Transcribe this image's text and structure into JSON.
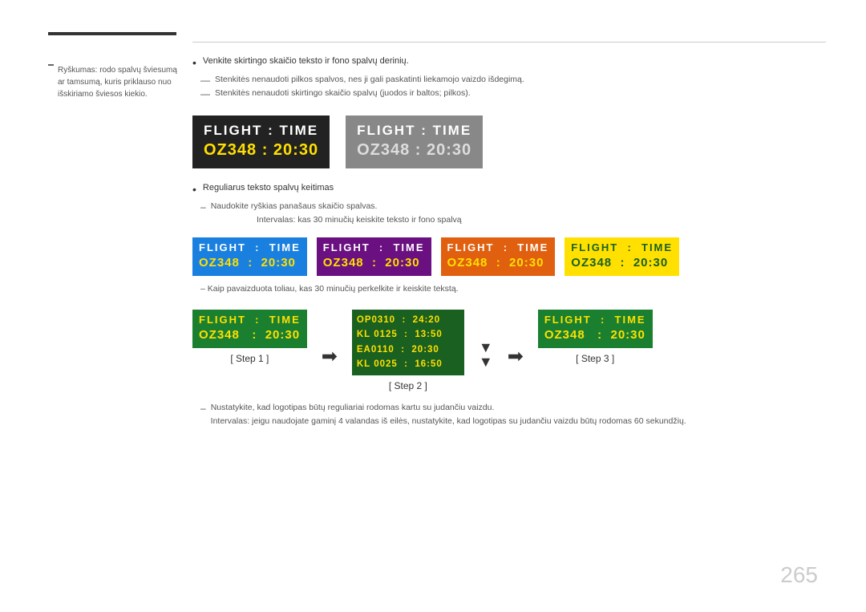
{
  "page": {
    "number": "265"
  },
  "sidebar": {
    "dash_label": "—",
    "text": "Ryškumas: rodo spalvų šviesumą ar tamsumą, kuris priklauso nuo išskiriamo šviesos kiekio."
  },
  "bullets": {
    "item1": "Venkite skirtingo skaičio teksto ir fono spalvų derinių.",
    "dash1": "Stenkitės nenaudoti pilkos spalvos, nes ji gali paskatinti liekamojo vaizdo išdegimą.",
    "dash2": "Stenkitės nenaudoti skirtingo skaičio spalvų (juodos ir baltos; pilkos)."
  },
  "big_boxes": {
    "box1": {
      "row1": "FLIGHT  :  TIME",
      "row2": "OZ348   :  20:30"
    },
    "box2": {
      "row1": "FLIGHT  :  TIME",
      "row2": "OZ348   :  20:30"
    }
  },
  "reguliarus": {
    "label": "Reguliarus teksto spalvų keitimas",
    "sub1": "Naudokite ryškias panašaus skaičio spalvas.",
    "sub2": "Intervalas: kas 30 minučių keiskite teksto ir fono spalvą"
  },
  "color_boxes": [
    {
      "row1": "FLIGHT  :  TIME",
      "row2": "OZ348  :  20:30",
      "type": "blue"
    },
    {
      "row1": "FLIGHT  :  TIME",
      "row2": "OZ348  :  20:30",
      "type": "purple"
    },
    {
      "row1": "FLIGHT  :  TIME",
      "row2": "OZ348  :  20:30",
      "type": "orange"
    },
    {
      "row1": "FLIGHT  :  TIME",
      "row2": "OZ348  :  20:30",
      "type": "yellow"
    }
  ],
  "note_scroll": "– Kaip pavaizduota toliau, kas 30 minučių perkelkite ir keiskite tekstą.",
  "steps": {
    "step1": {
      "label": "[ Step 1 ]",
      "row1": "FLIGHT  :  TIME",
      "row2": "OZ348   :  20:30"
    },
    "step2": {
      "label": "[ Step 2 ]",
      "rows": [
        "OP0310  :  24:20",
        "KL0125  :  13:50",
        "EA0110  :  20:30",
        "KL0025  :  16:50"
      ]
    },
    "step3": {
      "label": "[ Step 3 ]",
      "row1": "FLIGHT  :  TIME",
      "row2": "OZ348   :  20:30"
    }
  },
  "bottom_notes": {
    "dash1": "Nustatykite, kad logotipas būtų reguliariai rodomas kartu su judančiu vaizdu.",
    "dash2": "Intervalas: jeigu naudojate gaminį 4 valandas iš eilės, nustatykite, kad logotipas su judančiu vaizdu būtų rodomas 60 sekundžių."
  }
}
